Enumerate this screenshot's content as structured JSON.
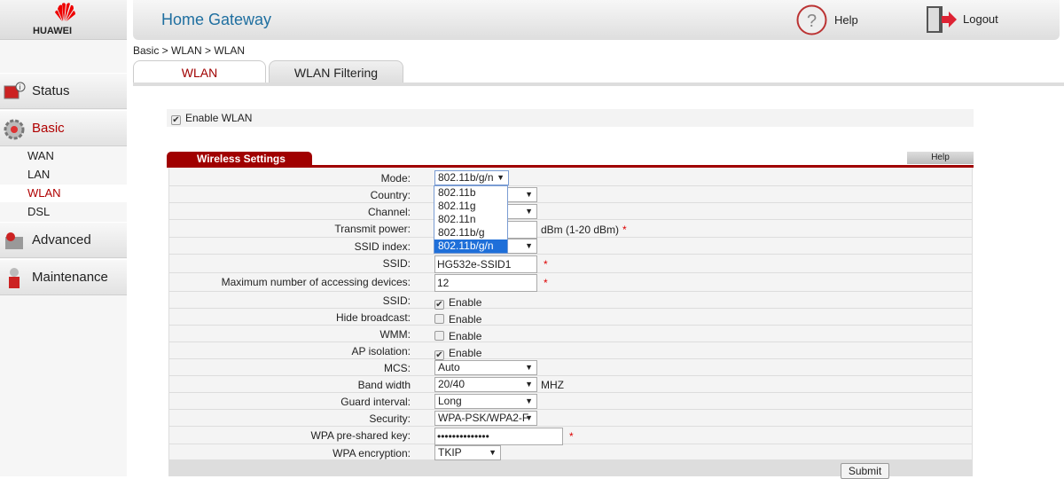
{
  "brand": "HUAWEI",
  "header": {
    "title": "Home Gateway",
    "help": "Help",
    "logout": "Logout"
  },
  "breadcrumb": "Basic > WLAN > WLAN",
  "sidebar": {
    "status": "Status",
    "basic": "Basic",
    "sub": [
      "WAN",
      "LAN",
      "WLAN",
      "DSL"
    ],
    "advanced": "Advanced",
    "maintenance": "Maintenance"
  },
  "tabs": [
    "WLAN",
    "WLAN Filtering"
  ],
  "enable_wlan": "Enable WLAN",
  "section": {
    "title": "Wireless Settings",
    "help": "Help"
  },
  "fields": [
    {
      "label": "Mode:",
      "type": "select",
      "value": "802.11b/g/n"
    },
    {
      "label": "Country:",
      "type": "select",
      "value": ""
    },
    {
      "label": "Channel:",
      "type": "select",
      "value": ""
    },
    {
      "label": "Transmit power:",
      "type": "input",
      "value": "",
      "suffix": "dBm (1-20 dBm)",
      "required": true
    },
    {
      "label": "SSID index:",
      "type": "select",
      "value": ""
    },
    {
      "label": "SSID:",
      "type": "input",
      "value": "HG532e-SSID1",
      "required": true
    },
    {
      "label": "Maximum number of accessing devices:",
      "type": "input",
      "value": "12",
      "required": true
    },
    {
      "label": "SSID:",
      "type": "check",
      "checked": true,
      "value": "Enable"
    },
    {
      "label": "Hide broadcast:",
      "type": "check",
      "checked": false,
      "value": "Enable"
    },
    {
      "label": "WMM:",
      "type": "check",
      "checked": false,
      "value": "Enable"
    },
    {
      "label": "AP isolation:",
      "type": "check",
      "checked": true,
      "value": "Enable"
    },
    {
      "label": "MCS:",
      "type": "select",
      "value": "Auto"
    },
    {
      "label": "Band width",
      "type": "select",
      "value": "20/40",
      "suffix": "MHZ"
    },
    {
      "label": "Guard interval:",
      "type": "select",
      "value": "Long"
    },
    {
      "label": "Security:",
      "type": "select",
      "value": "WPA-PSK/WPA2-F"
    },
    {
      "label": "WPA pre-shared key:",
      "type": "password",
      "value": "••••••••••••••",
      "required": true
    },
    {
      "label": "WPA encryption:",
      "type": "select",
      "value": "TKIP",
      "narrow": true
    }
  ],
  "mode_options": [
    "802.11b",
    "802.11g",
    "802.11n",
    "802.11b/g",
    "802.11b/g/n"
  ],
  "mode_selected_index": 4,
  "submit": "Submit",
  "colors": {
    "accent": "#a00000",
    "title": "#1f6fa0",
    "highlight": "#1e6fd9"
  }
}
